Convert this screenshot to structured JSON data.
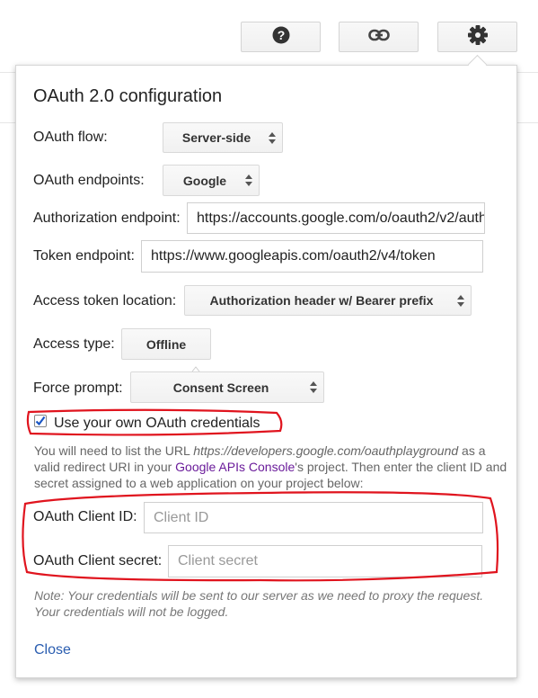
{
  "toolbar": {
    "help_icon": "help-icon",
    "link_icon": "link-icon",
    "settings_icon": "gear-icon"
  },
  "panel": {
    "title": "OAuth 2.0 configuration",
    "oauth_flow": {
      "label": "OAuth flow:",
      "value": "Server-side"
    },
    "oauth_endpoints": {
      "label": "OAuth endpoints:",
      "value": "Google"
    },
    "authorization_endpoint": {
      "label": "Authorization endpoint:",
      "value": "https://accounts.google.com/o/oauth2/v2/auth"
    },
    "token_endpoint": {
      "label": "Token endpoint:",
      "value": "https://www.googleapis.com/oauth2/v4/token"
    },
    "access_token_location": {
      "label": "Access token location:",
      "value": "Authorization header w/ Bearer prefix"
    },
    "access_type": {
      "label": "Access type:",
      "value": "Offline"
    },
    "force_prompt": {
      "label": "Force prompt:",
      "value": "Consent Screen"
    },
    "use_own_credentials": {
      "label": "Use your own OAuth credentials",
      "checked": true
    },
    "info": {
      "part1": "You will need to list the URL ",
      "url": "https://developers.google.com/oauthplayground",
      "part2": " as a valid redirect URI in your ",
      "console_link": "Google APIs Console",
      "part3": "'s project. Then enter the client ID and secret assigned to a web application on your project below:"
    },
    "client_id": {
      "label": "OAuth Client ID:",
      "placeholder": "Client ID"
    },
    "client_secret": {
      "label": "OAuth Client secret:",
      "placeholder": "Client secret"
    },
    "note": "Note: Your credentials will be sent to our server as we need to proxy the request. Your credentials will not be logged.",
    "close_label": "Close"
  },
  "colors": {
    "annotation_red": "#e0141e",
    "link_blue": "#2a5db0",
    "link_purple": "#6a1b9a"
  }
}
